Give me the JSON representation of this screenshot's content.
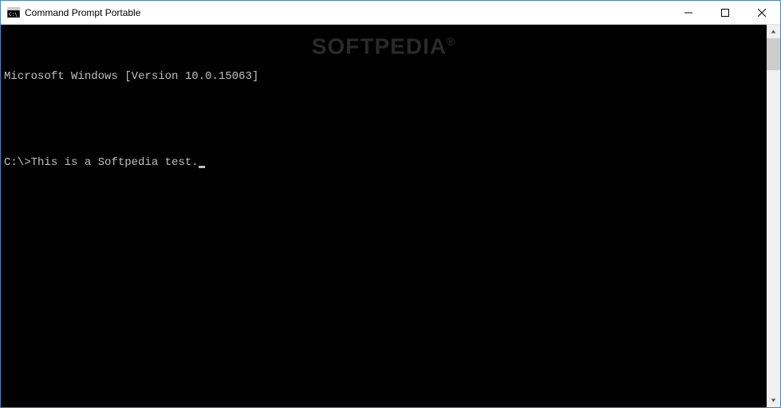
{
  "window": {
    "title": "Command Prompt Portable"
  },
  "terminal": {
    "header_line": "Microsoft Windows [Version 10.0.15063]",
    "prompt": "C:\\>",
    "input_text": "This is a Softpedia test."
  },
  "watermark": {
    "text": "SOFTPEDIA",
    "symbol": "®"
  }
}
